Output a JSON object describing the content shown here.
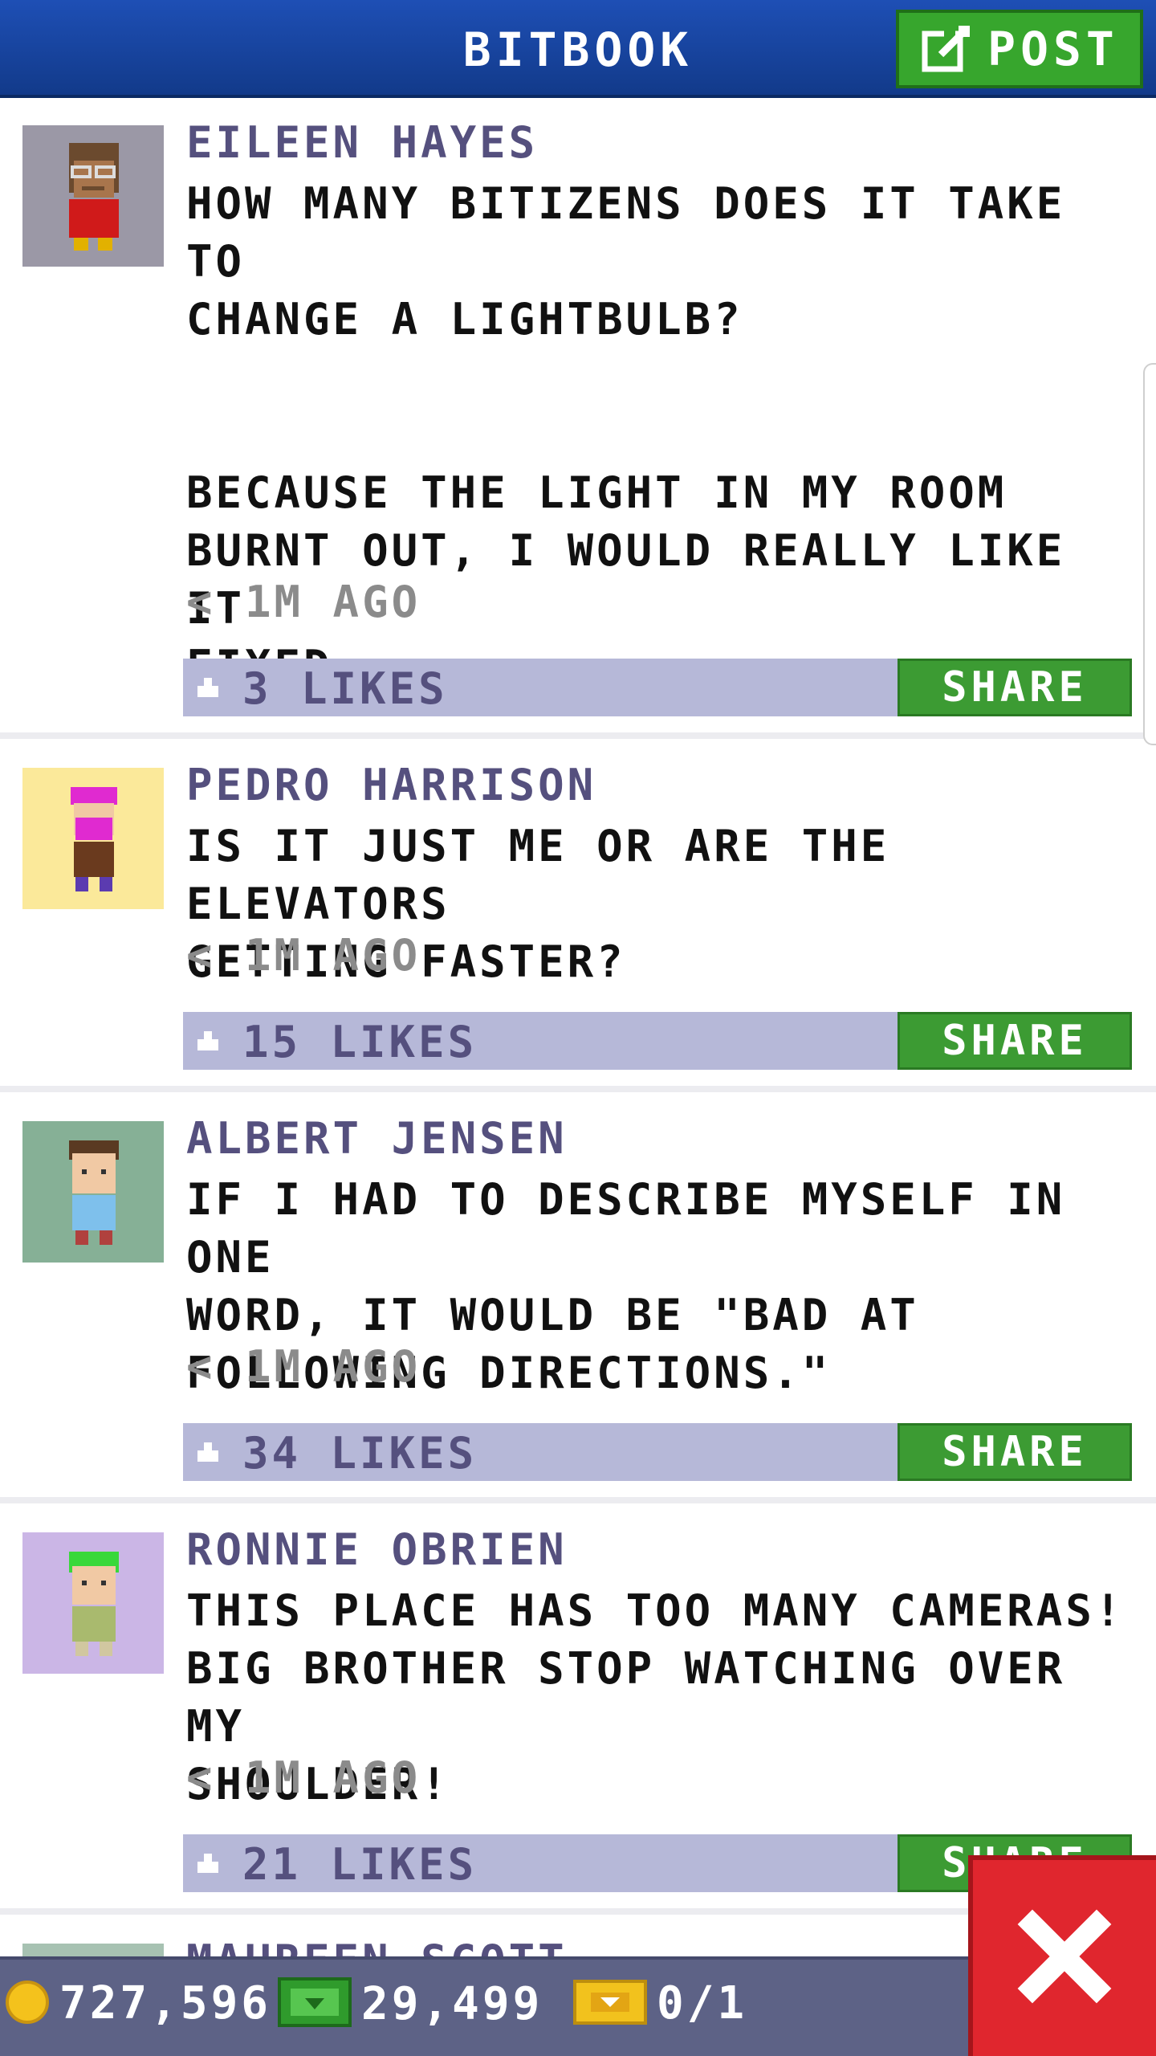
{
  "header": {
    "title": "BITBOOK",
    "post_label": "POST"
  },
  "posts": [
    {
      "author": "EILEEN HAYES",
      "message": "HOW MANY BITIZENS DOES IT TAKE TO\nCHANGE A LIGHTBULB?\n\n\nBECAUSE THE LIGHT IN MY ROOM\nBURNT OUT, I WOULD REALLY LIKE IT\nFIXED.",
      "time": "< 1M AGO",
      "likes": "3 LIKES",
      "share": "SHARE",
      "avatar_bg": "#9b98a6"
    },
    {
      "author": "PEDRO HARRISON",
      "message": "IS IT JUST ME OR ARE THE ELEVATORS\nGETTING FASTER?",
      "time": "< 1M AGO",
      "likes": "15 LIKES",
      "share": "SHARE",
      "avatar_bg": "#fbe99a"
    },
    {
      "author": "ALBERT JENSEN",
      "message": "IF I HAD TO DESCRIBE MYSELF IN ONE\nWORD, IT WOULD BE \"BAD AT\nFOLLOWING DIRECTIONS.\"",
      "time": "< 1M AGO",
      "likes": "34 LIKES",
      "share": "SHARE",
      "avatar_bg": "#86b096"
    },
    {
      "author": "RONNIE OBRIEN",
      "message": "THIS PLACE HAS TOO MANY CAMERAS!\nBIG BROTHER STOP WATCHING OVER MY\nSHOULDER!",
      "time": "< 1M AGO",
      "likes": "21 LIKES",
      "share": "SHARE",
      "avatar_bg": "#cbb6e6"
    },
    {
      "author": "MAUREEN SCOTT",
      "avatar_bg": "#a7c2b2"
    }
  ],
  "footer": {
    "coins": "727,596",
    "bux": "29,499",
    "tickets": "0/1"
  },
  "colors": {
    "header_bg": "#1e4fb5",
    "post_button": "#37a62d",
    "share_button": "#3c9b33",
    "likes_bar": "#b6b8d8",
    "author_text": "#55507e",
    "footer_bg": "#5d6286",
    "close_button": "#e0262e"
  },
  "icons": {
    "post": "edit-icon",
    "like": "thumbs-up-icon",
    "coins": "coin-icon",
    "bux": "bux-icon",
    "tickets": "ticket-icon",
    "close": "close-icon"
  }
}
